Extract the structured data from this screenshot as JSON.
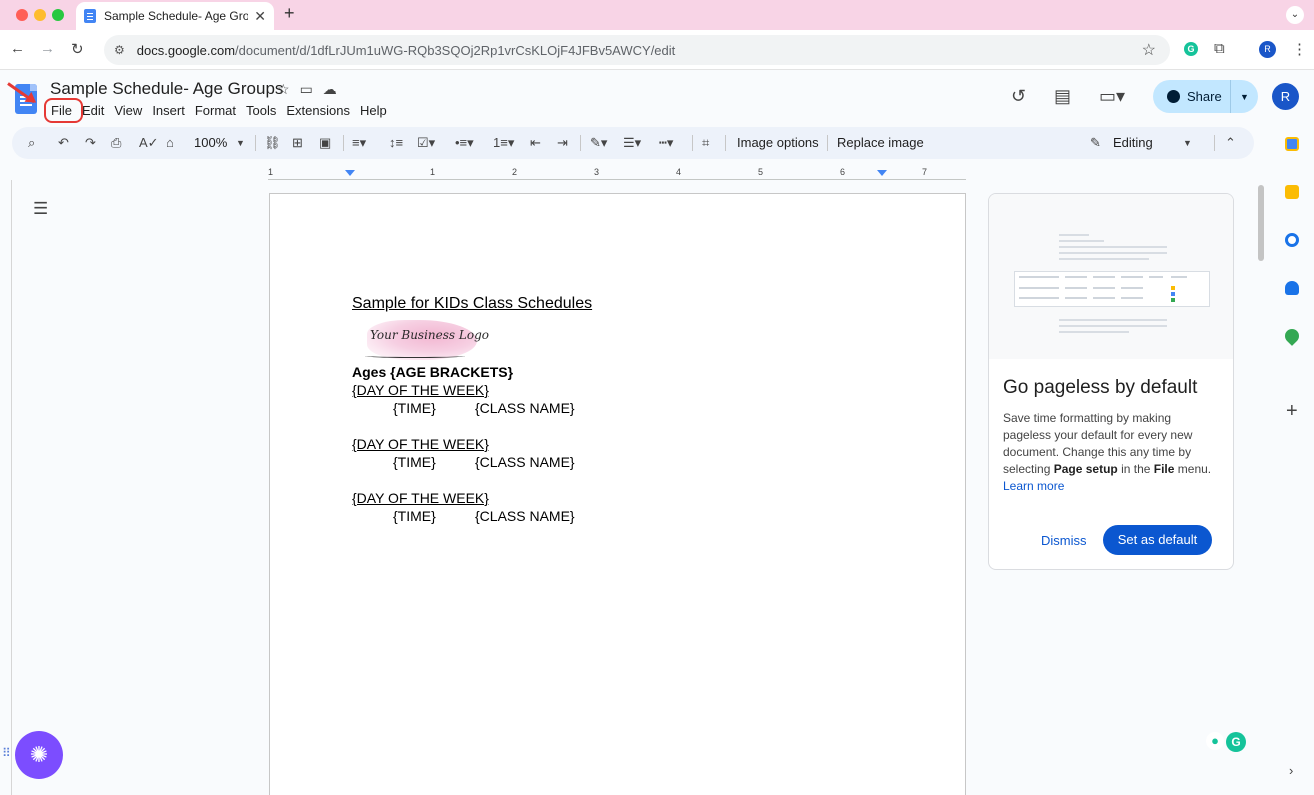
{
  "browser": {
    "tab_title": "Sample Schedule- Age Group",
    "url_host": "docs.google.com",
    "url_path": "/document/d/1dfLrJUm1uWG-RQb3SQOj2Rp1vrCsKLOjF4JFBv5AWCY/edit",
    "profile_initial": "R"
  },
  "docs": {
    "title": "Sample Schedule- Age Groups",
    "menu": [
      "File",
      "Edit",
      "View",
      "Insert",
      "Format",
      "Tools",
      "Extensions",
      "Help"
    ],
    "share_label": "Share",
    "profile_initial": "R"
  },
  "toolbar": {
    "zoom": "100%",
    "image_options": "Image options",
    "replace_image": "Replace image",
    "mode": "Editing"
  },
  "ruler": {
    "numbers": [
      "1",
      "1",
      "2",
      "3",
      "4",
      "5",
      "6",
      "7"
    ]
  },
  "document": {
    "heading": "Sample for KIDs Class Schedules",
    "logo_text": "Your Business Logo",
    "ages": "Ages {AGE BRACKETS}",
    "blocks": [
      {
        "day": "{DAY OF THE WEEK}",
        "time": "{TIME}",
        "class": "{CLASS NAME}"
      },
      {
        "day": "{DAY OF THE WEEK}",
        "time": "{TIME}",
        "class": "{CLASS NAME}"
      },
      {
        "day": "{DAY OF THE WEEK}",
        "time": "{TIME}",
        "class": "{CLASS NAME}"
      }
    ]
  },
  "pageless_card": {
    "title": "Go pageless by default",
    "body_1": "Save time formatting by making pageless your default for every new document. Change this any time by selecting ",
    "body_bold_1": "Page setup",
    "body_2": " in the ",
    "body_bold_2": "File",
    "body_3": " menu.",
    "learn_more": "Learn more",
    "dismiss": "Dismiss",
    "set_default": "Set as default"
  },
  "colors": {
    "tabbar": "#f8d4e6",
    "accent_blue": "#0b57d0",
    "share_bg": "#c2e7ff",
    "highlight_red": "#e53935"
  },
  "icons": {
    "side_panel": [
      "calendar-icon",
      "keep-icon",
      "tasks-icon",
      "contacts-icon",
      "maps-icon"
    ]
  }
}
